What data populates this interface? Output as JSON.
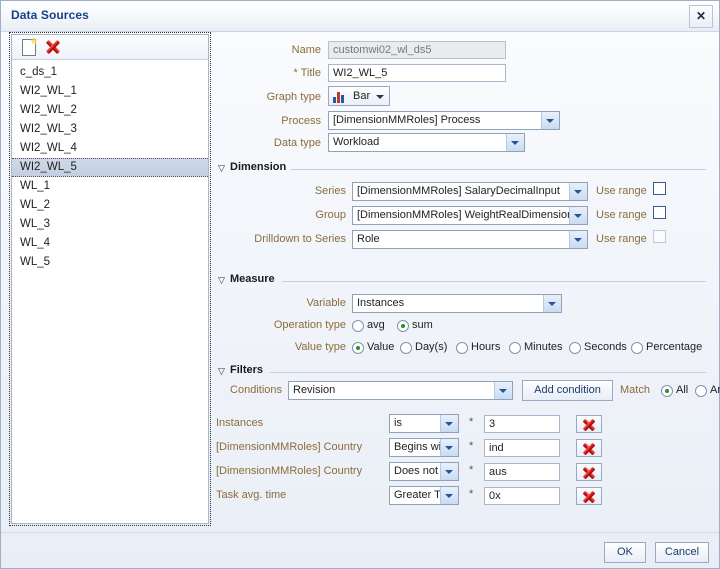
{
  "window": {
    "title": "Data Sources",
    "close_label": "✕"
  },
  "sidebar": {
    "toolbar": {
      "new_label": "new-data-source",
      "delete_label": "delete-data-source"
    },
    "items": [
      {
        "label": "c_ds_1",
        "selected": false
      },
      {
        "label": "WI2_WL_1",
        "selected": false
      },
      {
        "label": "WI2_WL_2",
        "selected": false
      },
      {
        "label": "WI2_WL_3",
        "selected": false
      },
      {
        "label": "WI2_WL_4",
        "selected": false
      },
      {
        "label": "WI2_WL_5",
        "selected": true
      },
      {
        "label": "WL_1",
        "selected": false
      },
      {
        "label": "WL_2",
        "selected": false
      },
      {
        "label": "WL_3",
        "selected": false
      },
      {
        "label": "WL_4",
        "selected": false
      },
      {
        "label": "WL_5",
        "selected": false
      }
    ]
  },
  "form": {
    "name": {
      "label": "Name",
      "value": "customwi02_wl_ds5"
    },
    "title": {
      "label": "Title",
      "value": "WI2_WL_5",
      "required": true
    },
    "graph_type": {
      "label": "Graph type",
      "value": "Bar"
    },
    "process": {
      "label": "Process",
      "value": "[DimensionMMRoles] Process"
    },
    "data_type": {
      "label": "Data type",
      "value": "Workload"
    }
  },
  "dimension": {
    "section_title": "Dimension",
    "use_range_label": "Use range",
    "rows": [
      {
        "label": "Series",
        "value": "[DimensionMMRoles] SalaryDecimalInput",
        "use_range": false,
        "disabled": false
      },
      {
        "label": "Group",
        "value": "[DimensionMMRoles] WeightRealDimension",
        "use_range": false,
        "disabled": false
      },
      {
        "label": "Drilldown to Series",
        "value": "Role",
        "use_range": false,
        "disabled": true
      }
    ]
  },
  "measure": {
    "section_title": "Measure",
    "variable": {
      "label": "Variable",
      "value": "Instances"
    },
    "operation_type": {
      "label": "Operation type",
      "options": [
        "avg",
        "sum"
      ],
      "selected": "sum"
    },
    "value_type": {
      "label": "Value type",
      "options": [
        "Value",
        "Day(s)",
        "Hours",
        "Minutes",
        "Seconds",
        "Percentage"
      ],
      "selected": "Value"
    }
  },
  "filters": {
    "section_title": "Filters",
    "conditions": {
      "label": "Conditions",
      "value": "Revision"
    },
    "add_condition_label": "Add condition",
    "match": {
      "label": "Match",
      "options": [
        "All",
        "An"
      ],
      "selected": "All"
    },
    "rows": [
      {
        "field": "Instances",
        "operator": "is",
        "star": "*",
        "value": "3"
      },
      {
        "field": "[DimensionMMRoles] Country",
        "operator": "Begins with",
        "star": "*",
        "value": "ind"
      },
      {
        "field": "[DimensionMMRoles] Country",
        "operator": "Does not c",
        "star": "*",
        "value": "aus"
      },
      {
        "field": "Task avg. time",
        "operator": "Greater Th",
        "star": "*",
        "value": "0x"
      }
    ]
  },
  "footer": {
    "ok_label": "OK",
    "cancel_label": "Cancel"
  }
}
